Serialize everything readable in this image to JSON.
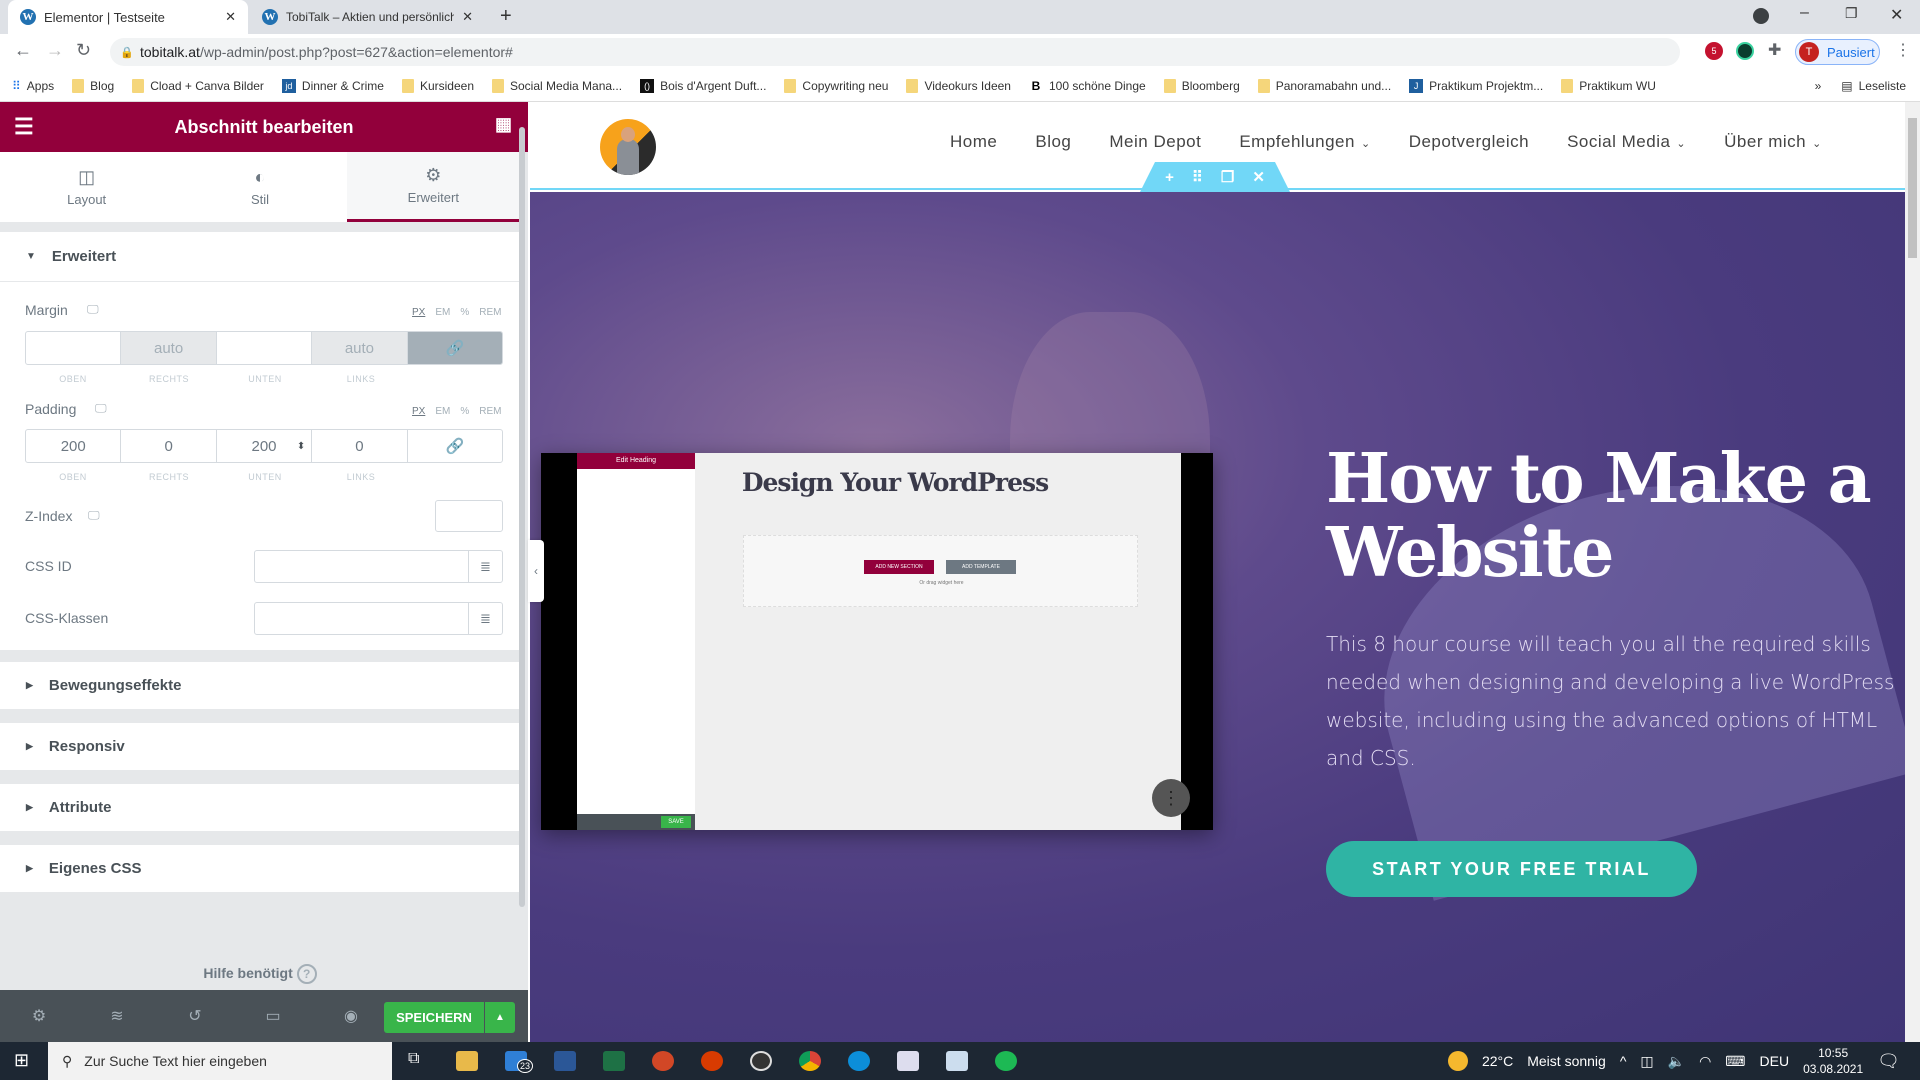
{
  "browser": {
    "tabs": [
      {
        "title": "Elementor | Testseite",
        "active": true
      },
      {
        "title": "TobiTalk – Aktien und persönliche",
        "active": false
      }
    ],
    "url_host": "tobitalk.at",
    "url_path": "/wp-admin/post.php?post=627&action=elementor#",
    "profile_label": "Pausiert",
    "profile_initial": "T",
    "extension_badge": "5",
    "bookmarks": [
      {
        "label": "Apps",
        "icon": "apps-icon"
      },
      {
        "label": "Blog",
        "icon": "folder-icon"
      },
      {
        "label": "Cload + Canva Bilder",
        "icon": "folder-icon"
      },
      {
        "label": "Dinner & Crime",
        "icon": "jd-icon"
      },
      {
        "label": "Kursideen",
        "icon": "folder-icon"
      },
      {
        "label": "Social Media Mana...",
        "icon": "folder-icon"
      },
      {
        "label": "Bois d'Argent Duft...",
        "icon": "site-icon"
      },
      {
        "label": "Copywriting neu",
        "icon": "folder-icon"
      },
      {
        "label": "Videokurs Ideen",
        "icon": "folder-icon"
      },
      {
        "label": "100 schöne Dinge",
        "icon": "b-icon"
      },
      {
        "label": "Bloomberg",
        "icon": "folder-icon"
      },
      {
        "label": "Panoramabahn und...",
        "icon": "folder-icon"
      },
      {
        "label": "Praktikum Projektm...",
        "icon": "j-icon"
      },
      {
        "label": "Praktikum WU",
        "icon": "folder-icon"
      }
    ],
    "reading_list": "Leseliste"
  },
  "panel": {
    "title": "Abschnitt bearbeiten",
    "tabs": [
      {
        "label": "Layout",
        "icon": "columns-icon"
      },
      {
        "label": "Stil",
        "icon": "contrast-icon"
      },
      {
        "label": "Erweitert",
        "icon": "gear-icon",
        "active": true
      }
    ],
    "section_title": "Erweitert",
    "units": [
      "PX",
      "EM",
      "%",
      "REM"
    ],
    "dim_labels": [
      "OBEN",
      "RECHTS",
      "UNTEN",
      "LINKS"
    ],
    "margin": {
      "label": "Margin",
      "values": [
        "",
        "auto",
        "",
        "auto"
      ]
    },
    "padding": {
      "label": "Padding",
      "values": [
        "200",
        "0",
        "200",
        "0"
      ]
    },
    "zindex": {
      "label": "Z-Index",
      "value": ""
    },
    "css_id": {
      "label": "CSS ID",
      "value": ""
    },
    "css_classes": {
      "label": "CSS-Klassen",
      "value": ""
    },
    "collapsed_sections": [
      "Bewegungseffekte",
      "Responsiv",
      "Attribute",
      "Eigenes CSS"
    ],
    "help": "Hilfe benötigt",
    "save": "SPEICHERN"
  },
  "site": {
    "nav": [
      {
        "label": "Home"
      },
      {
        "label": "Blog"
      },
      {
        "label": "Mein Depot"
      },
      {
        "label": "Empfehlungen",
        "dropdown": true
      },
      {
        "label": "Depotvergleich"
      },
      {
        "label": "Social Media",
        "dropdown": true
      },
      {
        "label": "Über mich",
        "dropdown": true
      }
    ],
    "hero_title": "How to Make a Website",
    "hero_text": "This 8 hour course will teach you all the required skills needed when designing and developing a live WordPress website, including using the advanced options of HTML and CSS.",
    "cta": "START YOUR FREE TRIAL",
    "video": {
      "panel_title": "Edit Heading",
      "canvas_heading": "Design Your WordPress",
      "add_section": "ADD NEW SECTION",
      "add_template": "ADD TEMPLATE",
      "drag_hint": "Or drag widget here",
      "save": "SAVE"
    }
  },
  "colors": {
    "elementor": "#92003b",
    "save": "#39b54a",
    "cta": "#2fb4a4",
    "editor_blue": "#71d7f7"
  },
  "taskbar": {
    "search_placeholder": "Zur Suche Text hier eingeben",
    "mail_badge": "23",
    "weather": "22°C",
    "weather_text": "Meist sonnig",
    "lang": "DEU",
    "time": "10:55",
    "date": "03.08.2021"
  }
}
